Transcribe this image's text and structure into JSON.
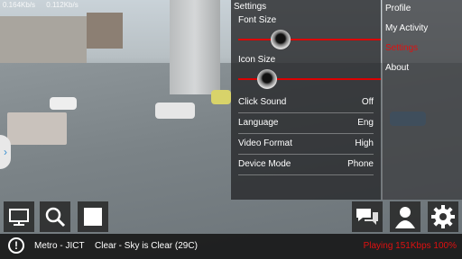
{
  "stats": {
    "in": "0.164Kb/s",
    "out": "0.112Kb/s"
  },
  "settings": {
    "title": "Settings",
    "font_size_label": "Font Size",
    "font_size_level": 0.3,
    "icon_size_label": "Icon Size",
    "icon_size_level": 0.2,
    "rows": [
      {
        "key": "Click Sound",
        "value": "Off"
      },
      {
        "key": "Language",
        "value": "Eng"
      },
      {
        "key": "Video Format",
        "value": "High"
      },
      {
        "key": "Device Mode",
        "value": "Phone"
      }
    ]
  },
  "menu": {
    "items": [
      "Profile",
      "My Activity",
      "Settings",
      "About"
    ],
    "active_index": 2
  },
  "icons": {
    "left": [
      "monitor-icon",
      "search-icon",
      "stop-icon"
    ],
    "right": [
      "chat-icon",
      "user-icon",
      "gear-icon"
    ],
    "sidetab": "chevron-right-icon"
  },
  "status": {
    "location": "Metro - JICT",
    "weather": "Clear - Sky is Clear (29C)",
    "playback": "Playing 151Kbps 100%"
  },
  "colors": {
    "accent": "#e01010",
    "panel": "#2a2c2e"
  }
}
